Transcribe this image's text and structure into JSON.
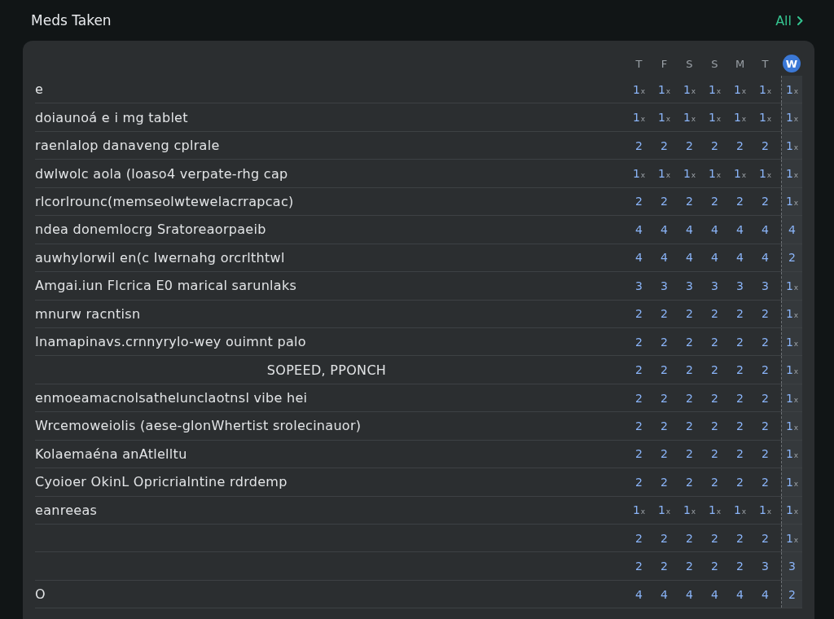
{
  "header": {
    "title": "Meds Taken",
    "link": {
      "label": "All"
    }
  },
  "days": [
    {
      "label": "T",
      "selected": false
    },
    {
      "label": "F",
      "selected": false
    },
    {
      "label": "S",
      "selected": false
    },
    {
      "label": "S",
      "selected": false
    },
    {
      "label": "M",
      "selected": false
    },
    {
      "label": "T",
      "selected": false
    },
    {
      "label": "W",
      "selected": true
    }
  ],
  "rows": [
    {
      "kind": "plain",
      "name": "e",
      "cells": [
        {
          "value": "1",
          "unit": "x"
        },
        {
          "value": "1",
          "unit": "x"
        },
        {
          "value": "1",
          "unit": "x"
        },
        {
          "value": "1",
          "unit": "x"
        },
        {
          "value": "1",
          "unit": "x"
        },
        {
          "value": "1",
          "unit": "x"
        },
        {
          "value": "1",
          "unit": "x"
        }
      ]
    },
    {
      "kind": "plain",
      "name": "doiaunoá e i mg tablet",
      "cells": [
        {
          "value": "1",
          "unit": "x"
        },
        {
          "value": "1",
          "unit": "x"
        },
        {
          "value": "1",
          "unit": "x"
        },
        {
          "value": "1",
          "unit": "x"
        },
        {
          "value": "1",
          "unit": "x"
        },
        {
          "value": "1",
          "unit": "x"
        },
        {
          "value": "1",
          "unit": "x"
        }
      ]
    },
    {
      "kind": "plain",
      "name": "raenlalop  danaveng  cplrale",
      "cells": [
        {
          "value": "2"
        },
        {
          "value": "2"
        },
        {
          "value": "2"
        },
        {
          "value": "2"
        },
        {
          "value": "2"
        },
        {
          "value": "2"
        },
        {
          "value": "1",
          "unit": "x"
        }
      ]
    },
    {
      "kind": "plain",
      "name": "dwlwolc aola (loaso4 verpate-rhg cap",
      "cells": [
        {
          "value": "1",
          "unit": "x"
        },
        {
          "value": "1",
          "unit": "x"
        },
        {
          "value": "1",
          "unit": "x"
        },
        {
          "value": "1",
          "unit": "x"
        },
        {
          "value": "1",
          "unit": "x"
        },
        {
          "value": "1",
          "unit": "x"
        },
        {
          "value": "1",
          "unit": "x"
        }
      ]
    },
    {
      "kind": "plain",
      "name": "rlcorlrounc(memseolwtewelacrrapcac)",
      "cells": [
        {
          "value": "2"
        },
        {
          "value": "2"
        },
        {
          "value": "2"
        },
        {
          "value": "2"
        },
        {
          "value": "2"
        },
        {
          "value": "2"
        },
        {
          "value": "1",
          "unit": "x"
        }
      ]
    },
    {
      "kind": "plain",
      "name": "ndea donemlocrg Sratoreaorpaeib",
      "cells": [
        {
          "value": "4"
        },
        {
          "value": "4"
        },
        {
          "value": "4"
        },
        {
          "value": "4"
        },
        {
          "value": "4"
        },
        {
          "value": "4"
        },
        {
          "value": "4"
        }
      ]
    },
    {
      "kind": "plain",
      "name": "auwhylorwil en(c      Iwernahg orcrlthtwl",
      "cells": [
        {
          "value": "4"
        },
        {
          "value": "4"
        },
        {
          "value": "4"
        },
        {
          "value": "4"
        },
        {
          "value": "4"
        },
        {
          "value": "4"
        },
        {
          "value": "2"
        }
      ]
    },
    {
      "kind": "plain",
      "name": "Amgai.iun Flcrica E0 marical sarunlaks",
      "cells": [
        {
          "value": "3"
        },
        {
          "value": "3"
        },
        {
          "value": "3"
        },
        {
          "value": "3"
        },
        {
          "value": "3"
        },
        {
          "value": "3"
        },
        {
          "value": "1",
          "unit": "x"
        }
      ]
    },
    {
      "kind": "plain",
      "name": "mnurw racntisn",
      "cells": [
        {
          "value": "2"
        },
        {
          "value": "2"
        },
        {
          "value": "2"
        },
        {
          "value": "2"
        },
        {
          "value": "2"
        },
        {
          "value": "2"
        },
        {
          "value": "1",
          "unit": "x"
        }
      ]
    },
    {
      "kind": "plain",
      "name": "Inamapinavs.crnnyrylo-wey ouimnt palo",
      "cells": [
        {
          "value": "2"
        },
        {
          "value": "2"
        },
        {
          "value": "2"
        },
        {
          "value": "2"
        },
        {
          "value": "2"
        },
        {
          "value": "2"
        },
        {
          "value": "1",
          "unit": "x"
        }
      ]
    },
    {
      "kind": "centered",
      "name": "SOPEED, PPONCH",
      "cells": [
        {
          "value": "2"
        },
        {
          "value": "2"
        },
        {
          "value": "2"
        },
        {
          "value": "2"
        },
        {
          "value": "2"
        },
        {
          "value": "2"
        },
        {
          "value": "1",
          "unit": "x"
        }
      ]
    },
    {
      "kind": "plain",
      "name": "enmoeamacnolsathelunclaotnsl vibe hei",
      "cells": [
        {
          "value": "2"
        },
        {
          "value": "2"
        },
        {
          "value": "2"
        },
        {
          "value": "2"
        },
        {
          "value": "2"
        },
        {
          "value": "2"
        },
        {
          "value": "1",
          "unit": "x"
        }
      ]
    },
    {
      "kind": "plain",
      "name": "Wrcemoweiolis (aese-glonWhertist  srolecinauor)",
      "cells": [
        {
          "value": "2"
        },
        {
          "value": "2"
        },
        {
          "value": "2"
        },
        {
          "value": "2"
        },
        {
          "value": "2"
        },
        {
          "value": "2"
        },
        {
          "value": "1",
          "unit": "x"
        }
      ]
    },
    {
      "kind": "plain",
      "name": "Kolaemaéna anAtlelltu",
      "cells": [
        {
          "value": "2"
        },
        {
          "value": "2"
        },
        {
          "value": "2"
        },
        {
          "value": "2"
        },
        {
          "value": "2"
        },
        {
          "value": "2"
        },
        {
          "value": "1",
          "unit": "x"
        }
      ]
    },
    {
      "kind": "plain",
      "name": "Cyoioer OkinL Opricrialntine  rdrdemp",
      "cells": [
        {
          "value": "2"
        },
        {
          "value": "2"
        },
        {
          "value": "2"
        },
        {
          "value": "2"
        },
        {
          "value": "2"
        },
        {
          "value": "2"
        },
        {
          "value": "1",
          "unit": "x"
        }
      ]
    },
    {
      "kind": "plain",
      "name": "eanreeas",
      "cells": [
        {
          "value": "1",
          "unit": "x"
        },
        {
          "value": "1",
          "unit": "x"
        },
        {
          "value": "1",
          "unit": "x"
        },
        {
          "value": "1",
          "unit": "x"
        },
        {
          "value": "1",
          "unit": "x"
        },
        {
          "value": "1",
          "unit": "x"
        },
        {
          "value": "1",
          "unit": "x"
        }
      ]
    },
    {
      "kind": "plain",
      "cells": [
        {
          "value": "2"
        },
        {
          "value": "2"
        },
        {
          "value": "2"
        },
        {
          "value": "2"
        },
        {
          "value": "2"
        },
        {
          "value": "2"
        },
        {
          "value": "1",
          "unit": "x"
        }
      ]
    },
    {
      "kind": "plain",
      "cells": [
        {
          "value": "2"
        },
        {
          "value": "2"
        },
        {
          "value": "2"
        },
        {
          "value": "2"
        },
        {
          "value": "2"
        },
        {
          "value": "3"
        },
        {
          "value": "3"
        }
      ]
    },
    {
      "kind": "plain",
      "name": "O",
      "cells": [
        {
          "value": "4"
        },
        {
          "value": "4"
        },
        {
          "value": "4"
        },
        {
          "value": "4"
        },
        {
          "value": "4"
        },
        {
          "value": "4"
        },
        {
          "value": "2"
        }
      ]
    }
  ]
}
